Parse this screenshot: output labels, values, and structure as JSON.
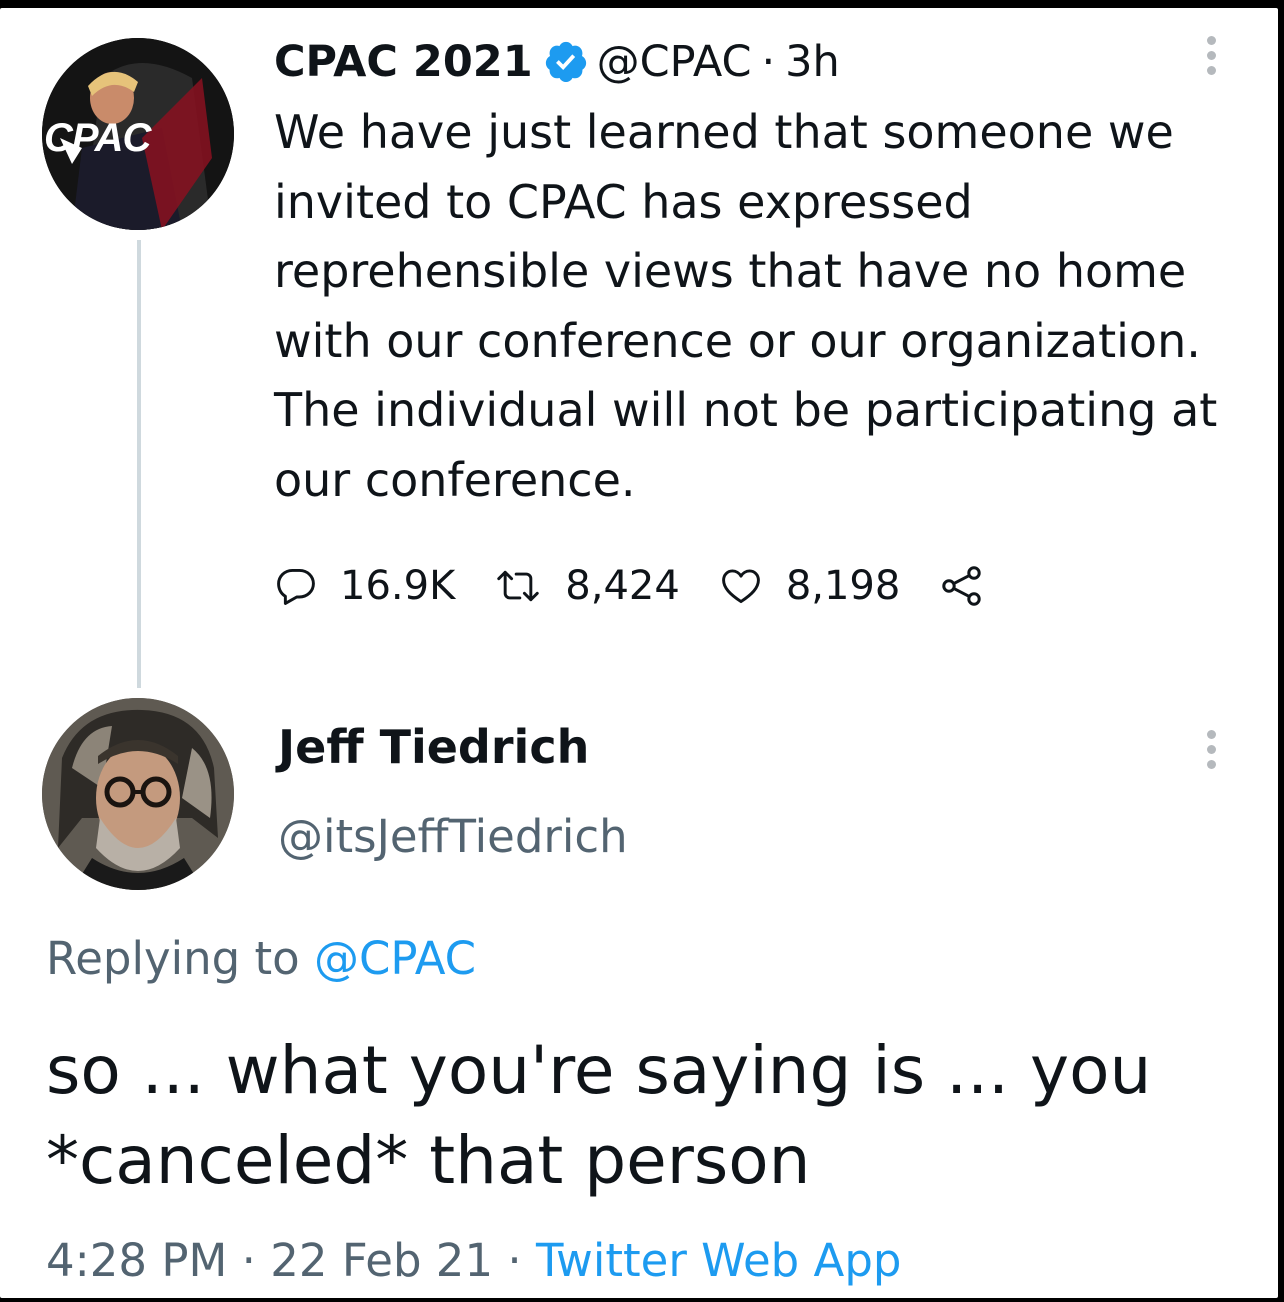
{
  "tweet": {
    "author_name": "CPAC 2021",
    "handle": "@CPAC",
    "separator": "·",
    "time": "3h",
    "text": "We have just learned that someone we invited to CPAC has expressed reprehensible views that have no home with our conference or our organization. The individual will not be participating at our conference.",
    "avatar_logo": "CPAC",
    "verified_icon": "verified-badge-icon",
    "stats": {
      "replies": "16.9K",
      "retweets": "8,424",
      "likes": "8,198"
    }
  },
  "reply": {
    "author_name": "Jeff Tiedrich",
    "handle": "@itsJeffTiedrich",
    "replying_prefix": "Replying to",
    "replying_to": "@CPAC",
    "text": "so ... what you're saying is ... you *canceled* that person",
    "time": "4:28 PM",
    "date": "22 Feb 21",
    "dot1": "·",
    "dot2": "·",
    "source": "Twitter Web App"
  },
  "colors": {
    "text": "#0f1419",
    "secondary": "#536471",
    "link": "#1d9bf0",
    "verified": "#1d9bf0",
    "thread_line": "#cfd9de"
  }
}
